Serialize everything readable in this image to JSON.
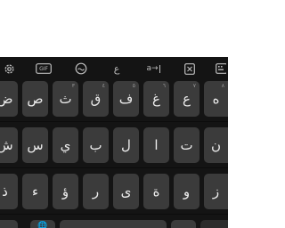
{
  "keyboard": {
    "toolbar": {
      "settings": "settings-icon",
      "gif": "GIF",
      "sticker": "sticker-icon",
      "transliterate": "ع",
      "translate": "a→",
      "clipboard": "clipboard-icon",
      "keyboard": "keyboard-icon"
    },
    "row1": [
      {
        "label": "ض",
        "hint": ""
      },
      {
        "label": "ص",
        "hint": ""
      },
      {
        "label": "ث",
        "hint": "٣"
      },
      {
        "label": "ق",
        "hint": "٤"
      },
      {
        "label": "ف",
        "hint": "٥"
      },
      {
        "label": "غ",
        "hint": "٦"
      },
      {
        "label": "ع",
        "hint": "٧"
      },
      {
        "label": "ه",
        "hint": "٨"
      }
    ],
    "row2": [
      {
        "label": "ش",
        "hint": ""
      },
      {
        "label": "س",
        "hint": ""
      },
      {
        "label": "ي",
        "hint": ""
      },
      {
        "label": "ب",
        "hint": ""
      },
      {
        "label": "ل",
        "hint": ""
      },
      {
        "label": "ا",
        "hint": ""
      },
      {
        "label": "ت",
        "hint": ""
      },
      {
        "label": "ن",
        "hint": ""
      }
    ],
    "row3": [
      {
        "label": "ذ",
        "hint": ""
      },
      {
        "label": "ء",
        "hint": ""
      },
      {
        "label": "ؤ",
        "hint": ""
      },
      {
        "label": "ر",
        "hint": ""
      },
      {
        "label": "ى",
        "hint": ""
      },
      {
        "label": "ة",
        "hint": ""
      },
      {
        "label": "و",
        "hint": ""
      },
      {
        "label": "ز",
        "hint": ""
      }
    ],
    "colors": {
      "background": "#141414",
      "key": "#3b3b3b",
      "key_text": "#ececec"
    }
  }
}
